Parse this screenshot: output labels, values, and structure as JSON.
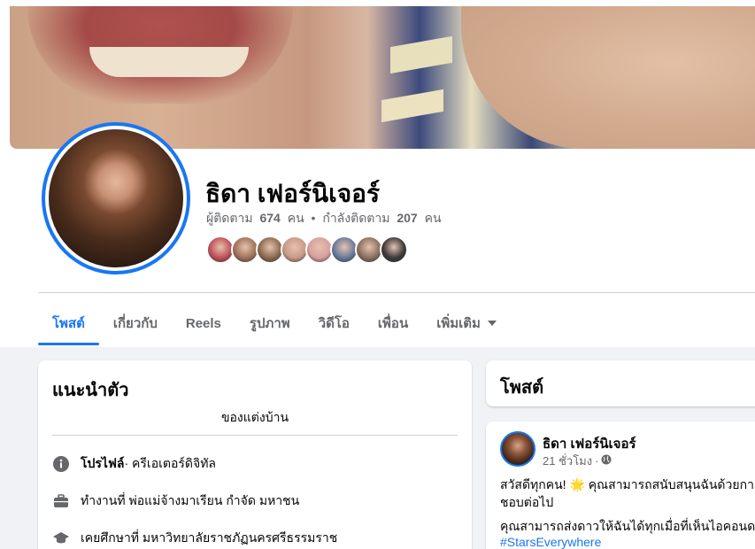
{
  "profile": {
    "name": "ธิดา เฟอร์นิเจอร์",
    "followers_label": "ผู้ติดตาม",
    "followers_count": "674",
    "followers_unit": "คน",
    "following_label": "กำลังติดตาม",
    "following_count": "207",
    "following_unit": "คน",
    "separator": "•"
  },
  "tabs": [
    {
      "label": "โพสต์",
      "active": true
    },
    {
      "label": "เกี่ยวกับ"
    },
    {
      "label": "Reels"
    },
    {
      "label": "รูปภาพ"
    },
    {
      "label": "วิดีโอ"
    },
    {
      "label": "เพื่อน"
    },
    {
      "label": "เพิ่มเติม"
    }
  ],
  "intro": {
    "title": "แนะนำตัว",
    "bio": "ของแต่งบ้าน",
    "profile_bold": "โปรไฟล์",
    "profile_rest": " · ครีเอเตอร์ดิจิทัล",
    "work": "ทำงานที่ พ่อแม่จ้างมาเรียน กำจัด มหาชน",
    "education": "เคยศึกษาที่ มหาวิทยาลัยราชภัฏนครศรีธรรมราช"
  },
  "posts_section": {
    "title": "โพสต์"
  },
  "post": {
    "author": "ธิดา เฟอร์นิเจอร์",
    "time": "21 ชั่วโมง",
    "audience_sep": "·",
    "line1_a": "สวัสดีทุกคน! ",
    "line1_emoji": "🌟",
    "line1_b": " คุณสามารถสนับสนุนฉันด้วยกา",
    "line2": "ชอบต่อไป",
    "line3": "คุณสามารถส่งดาวให้ฉันได้ทุกเมื่อที่เห็นไอคอนด",
    "hashtag": "#StarsEverywhere"
  },
  "colors": {
    "accent": "#1877f2",
    "secondary_text": "#65676b",
    "background": "#f0f2f5"
  },
  "friend_avatar_colors": [
    "#c0505a",
    "#a0725a",
    "#8c6a50",
    "#c89a88",
    "#d8a0a0",
    "#6a7a9a",
    "#8a7060",
    "#3a3a3a"
  ]
}
